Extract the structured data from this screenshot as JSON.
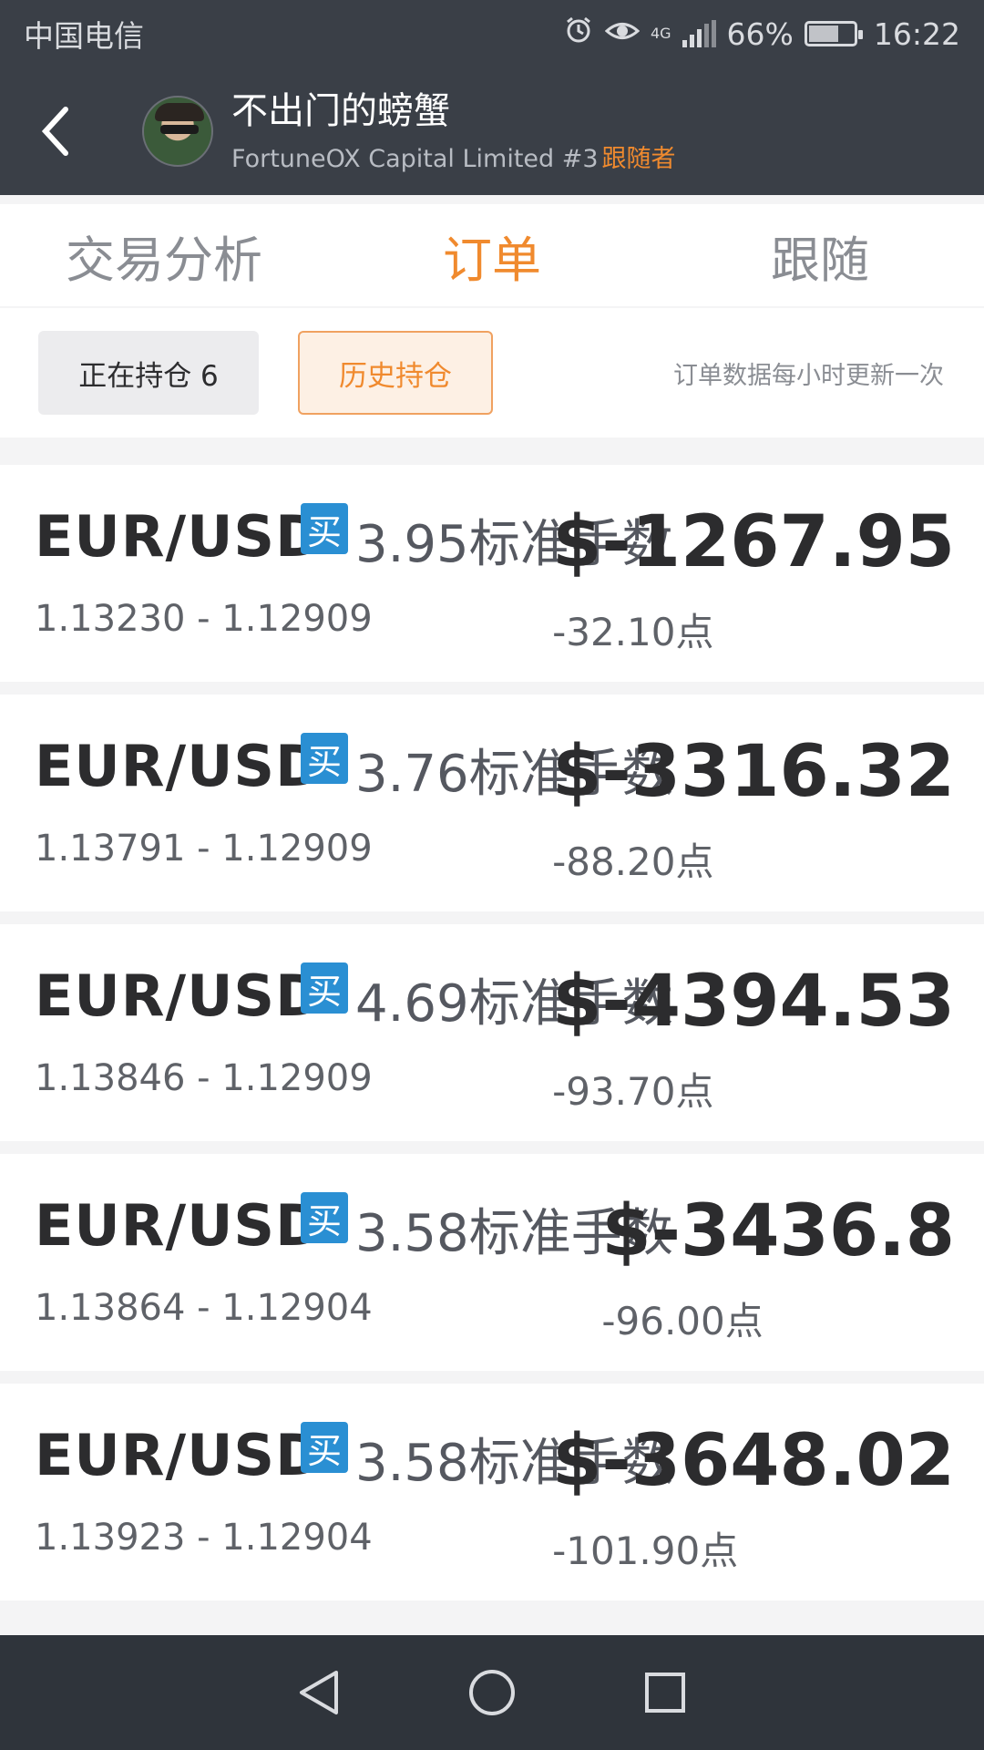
{
  "status_bar": {
    "carrier": "中国电信",
    "battery": "66%",
    "battery_level": 0.66,
    "network": "4G",
    "time": "16:22",
    "icons": [
      "alarm-icon",
      "eye-icon",
      "signal-icon",
      "battery-icon"
    ]
  },
  "header": {
    "name": "不出门的螃蟹",
    "account": "FortuneOX Capital Limited #3",
    "role": "跟随者"
  },
  "tabs": [
    {
      "label": "交易分析",
      "active": false
    },
    {
      "label": "订单",
      "active": true
    },
    {
      "label": "跟随",
      "active": false
    }
  ],
  "filter": {
    "open_positions": "正在持仓 6",
    "history": "历史持仓",
    "note": "订单数据每小时更新一次"
  },
  "colors": {
    "accent": "#f08a2e",
    "buy_badge": "#2a8fd3",
    "header_bg": "#3a3f47"
  },
  "orders": [
    {
      "pair": "EUR/USD",
      "side": "买",
      "lots": "3.95标准手数",
      "prices": "1.13230 - 1.12909",
      "profit": "$-1267.95",
      "pips": "-32.10点"
    },
    {
      "pair": "EUR/USD",
      "side": "买",
      "lots": "3.76标准手数",
      "prices": "1.13791 - 1.12909",
      "profit": "$-3316.32",
      "pips": "-88.20点"
    },
    {
      "pair": "EUR/USD",
      "side": "买",
      "lots": "4.69标准手数",
      "prices": "1.13846 - 1.12909",
      "profit": "$-4394.53",
      "pips": "-93.70点"
    },
    {
      "pair": "EUR/USD",
      "side": "买",
      "lots": "3.58标准手数",
      "prices": "1.13864 - 1.12904",
      "profit": "$-3436.8",
      "pips": "-96.00点"
    },
    {
      "pair": "EUR/USD",
      "side": "买",
      "lots": "3.58标准手数",
      "prices": "1.13923 - 1.12904",
      "profit": "$-3648.02",
      "pips": "-101.90点"
    }
  ],
  "navigation": [
    "back-nav-icon",
    "home-nav-icon",
    "recents-nav-icon"
  ]
}
